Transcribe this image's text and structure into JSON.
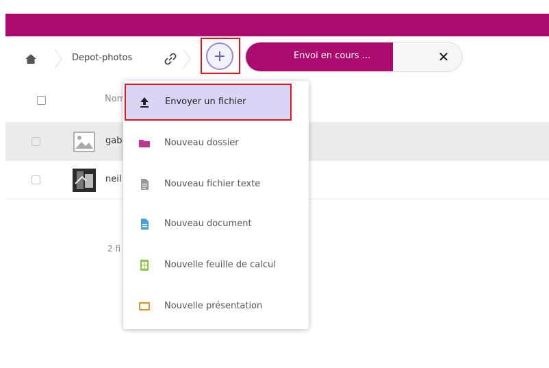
{
  "breadcrumb": {
    "folder": "Depot-photos"
  },
  "upload": {
    "status_label": "Envoi en cours ...",
    "progress_percent": 68
  },
  "table": {
    "header_name": "Nom",
    "rows": [
      {
        "name": "gab",
        "thumbnail": "image-placeholder-icon"
      },
      {
        "name": "neil",
        "thumbnail": "photo-thumbnail"
      }
    ],
    "footer": "2 fi"
  },
  "menu": {
    "items": [
      {
        "label": "Envoyer un fichier",
        "icon": "upload-icon"
      },
      {
        "label": "Nouveau dossier",
        "icon": "folder-icon"
      },
      {
        "label": "Nouveau fichier texte",
        "icon": "text-file-icon"
      },
      {
        "label": "Nouveau document",
        "icon": "document-icon"
      },
      {
        "label": "Nouvelle feuille de calcul",
        "icon": "spreadsheet-icon"
      },
      {
        "label": "Nouvelle présentation",
        "icon": "presentation-icon"
      }
    ]
  },
  "colors": {
    "brand": "#ab0b6e",
    "highlight_border": "#e3141b",
    "active_item_bg": "#d9d5f4",
    "folder": "#c2348e",
    "document": "#4a9fe0",
    "spreadsheet": "#8cc63f",
    "presentation": "#f08a24"
  }
}
